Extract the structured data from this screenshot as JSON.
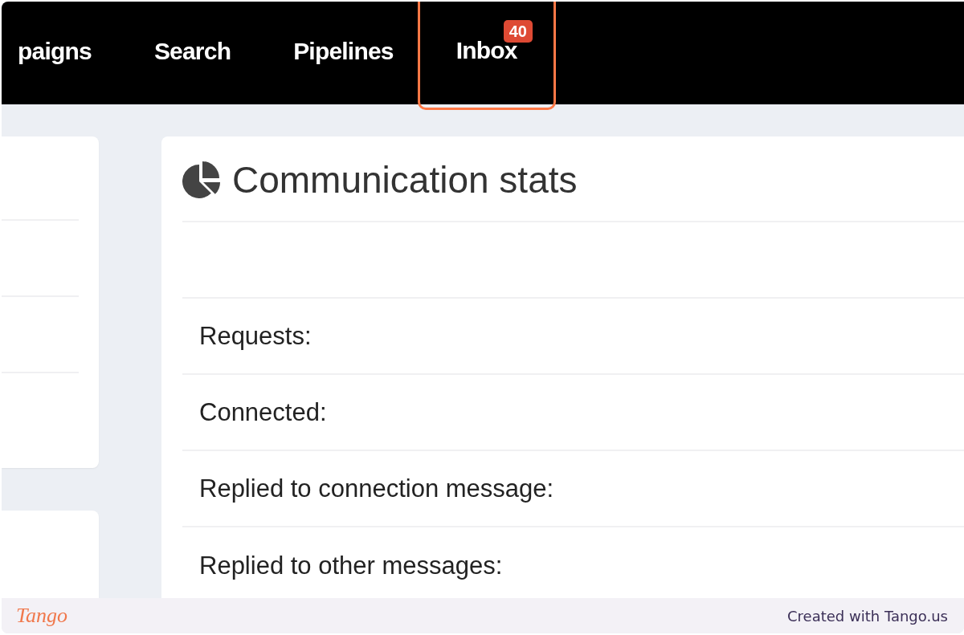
{
  "nav": {
    "items": [
      {
        "label": "paigns",
        "highlighted": false
      },
      {
        "label": "Search",
        "highlighted": false
      },
      {
        "label": "Pipelines",
        "highlighted": false
      },
      {
        "label": "Inbox",
        "badge": "40",
        "highlighted": true
      }
    ]
  },
  "stats": {
    "title": "Communication stats",
    "rows": [
      {
        "label": "Requests:"
      },
      {
        "label": "Connected:"
      },
      {
        "label": "Replied to connection message:"
      },
      {
        "label": "Replied to other messages:"
      }
    ]
  },
  "footer": {
    "logo": "Tango",
    "credit": "Created with Tango.us"
  }
}
